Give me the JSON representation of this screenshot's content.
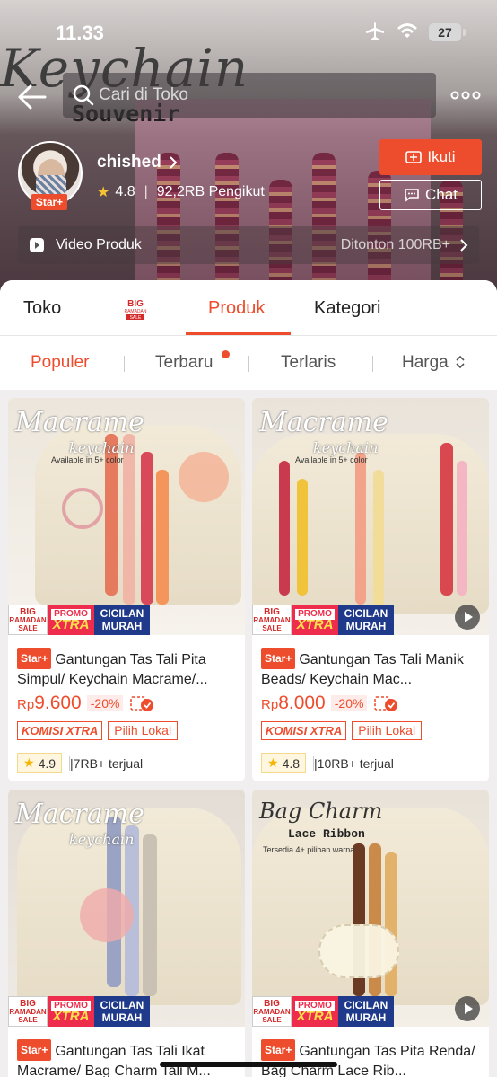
{
  "status": {
    "time": "11.33",
    "battery": "27"
  },
  "banner": {
    "script_text": "Keychain",
    "souvenir_text": "Souvenir"
  },
  "search": {
    "placeholder": "Cari di Toko"
  },
  "shop": {
    "name": "chished",
    "badge": "Star+",
    "rating": "4.8",
    "followers": "92,2RB Pengikut",
    "follow_label": "Ikuti",
    "chat_label": "Chat",
    "video_label": "Video Produk",
    "video_views": "Ditonton 100RB+"
  },
  "tabs": [
    {
      "label": "Toko"
    },
    {
      "label": "BIG RAMADAN SALE",
      "icon": "big-ramadan-sale-icon"
    },
    {
      "label": "Produk",
      "active": true
    },
    {
      "label": "Kategori"
    }
  ],
  "sort": [
    {
      "label": "Populer",
      "active": true
    },
    {
      "label": "Terbaru"
    },
    {
      "label": "Terlaris"
    },
    {
      "label": "Harga"
    }
  ],
  "promo_strip": {
    "big": "BIG",
    "ramadan": "RAMADAN",
    "sale": "SALE",
    "promo": "PROMO",
    "xtra": "XTRA",
    "cicilan": "CICILAN",
    "murah": "MURAH"
  },
  "products": [
    {
      "image_title": "Macrame",
      "image_sub": "keychain",
      "image_note": "Available in 5+ color",
      "badge": "Star+",
      "title": "Gantungan Tas Tali Pita Simpul/ Keychain Macrame/...",
      "currency": "Rp",
      "price": "9.600",
      "discount": "-20%",
      "tag1": "KOMISI XTRA",
      "tag2": "Pilih Lokal",
      "rating": "4.9",
      "sold": "7RB+ terjual",
      "has_video": false
    },
    {
      "image_title": "Macrame",
      "image_sub": "keychain",
      "image_note": "Available in 5+ color",
      "badge": "Star+",
      "title": "Gantungan Tas Tali Manik Beads/ Keychain Mac...",
      "currency": "Rp",
      "price": "8.000",
      "discount": "-20%",
      "tag1": "KOMISI XTRA",
      "tag2": "Pilih Lokal",
      "rating": "4.8",
      "sold": "10RB+ terjual",
      "has_video": true
    },
    {
      "image_title": "Macrame",
      "image_sub": "keychain",
      "badge": "Star+",
      "title": "Gantungan Tas Tali Ikat Macrame/ Bag Charm Tali M...",
      "has_video": false
    },
    {
      "image_title": "Bag Charm",
      "image_sub": "Lace Ribbon",
      "image_note": "Tersedia 4+ pilihan warna",
      "badge": "Star+",
      "title": "Gantungan Tas Pita Renda/ Bag Charm Lace Rib...",
      "has_video": true
    }
  ],
  "colors": {
    "accent": "#ee4d2d",
    "star": "#f6c332",
    "navy": "#1f3a8a"
  }
}
